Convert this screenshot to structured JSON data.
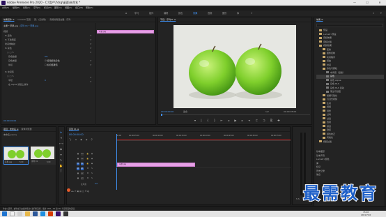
{
  "window": {
    "title": "Adobe Premiere Pro 2020 - C:\\用户\\Ydsq\\桌面\\未命名 *",
    "min": "—",
    "max": "☐",
    "close": "✕"
  },
  "menu": [
    "文件(F)",
    "编辑(E)",
    "剪辑(C)",
    "序列(S)",
    "标记(M)",
    "图形(G)",
    "视图(V)",
    "窗口(W)",
    "帮助(H)"
  ],
  "workspaces": [
    "学习",
    "组件",
    "编辑",
    "颜色",
    "效果",
    "音频",
    "图形",
    "库"
  ],
  "active_workspace": "效果",
  "effect_controls": {
    "tabs": [
      "效果控件 ≡",
      "Lumetri 范围",
      "源：(无剪辑)",
      "音频剪辑混合器：序列"
    ],
    "clip": "主要 * 苹果.jpg",
    "sequence": "序列 01 * 苹果.jpg",
    "timecode": "00:00:00:00",
    "sections": {
      "video": "视频",
      "motion": "fx 运动",
      "opacity": "fx 不透明度",
      "remap": "时间重映射",
      "noise": "fx 杂色",
      "noise_amount": "杂色数量",
      "noise_type": "杂色类型",
      "clipping": "剪切",
      "mode": "fx 中间值",
      "radius": "半径",
      "alpha": "在 Alpha 通道上操作",
      "noise_color": "使用颜色杂色",
      "clip_result": "剪切结果值"
    },
    "values": {
      "noise_amount": "0.0%",
      "radius": "0",
      "intensity": "0%",
      "checkbox1": "☑",
      "checkbox2": "☐"
    },
    "timeline_clip": "苹果.jpg"
  },
  "program": {
    "tab": "节目：序列01 ≡",
    "timecode_left": "00:00:00:00",
    "fit": "适合",
    "fraction": "1/2",
    "timecode_right": "00:00:05:00"
  },
  "effects_panel": {
    "title": "效果 ≡",
    "tree": [
      "预设",
      "Lumetri 预设",
      "音频效果",
      "音频过渡",
      "视频效果",
      "变换",
      "图像控制",
      "实用程序",
      "扭曲",
      "时间",
      "杂色与颗粒",
      "中间值（旧版）",
      "杂色",
      "杂色 Alpha",
      "杂色 HLS",
      "杂色 HLS 自动",
      "蒙尘与划痕",
      "模糊与锐化",
      "沉浸式视频",
      "生成",
      "视频",
      "调整",
      "过时",
      "过渡",
      "透视",
      "通道",
      "键控",
      "颜色校正",
      "风格化",
      "视频过渡"
    ],
    "bottom": [
      "基本图形",
      "基本声音",
      "Lumetri 颜色",
      "库",
      "标记",
      "历史记录",
      "信息"
    ]
  },
  "project": {
    "tabs": [
      "项目：未命名 ≡",
      "媒体浏览器"
    ],
    "filename": "未命名.prproj",
    "items": [
      "苹果.jpg",
      "序列 01"
    ],
    "durations": [
      "5:00",
      "5:00"
    ]
  },
  "timeline": {
    "tab": "序列 01 ≡",
    "timecode": "00:00:00:00",
    "ruler": [
      "00:00",
      "00:00:05:00",
      "00:00:10:00",
      "00:00:15:00",
      "00:00:20:00",
      "00:00:25:00",
      "00:00:30:00",
      "00:00:35:00"
    ],
    "tracks": [
      "V3",
      "V2",
      "V1",
      "A1",
      "A2",
      "A3",
      "主声道"
    ],
    "master_value": "0.0",
    "clip": "苹果.jpg"
  },
  "status_bar": "单击以选择，或单击空白处并拖动以进行框选择。使用 Shift、Alt 和 Ctrl 可获得其他选项。",
  "watermark": "最需教育",
  "taskbar": {
    "time": "15:10",
    "date": "2021/7/10"
  }
}
